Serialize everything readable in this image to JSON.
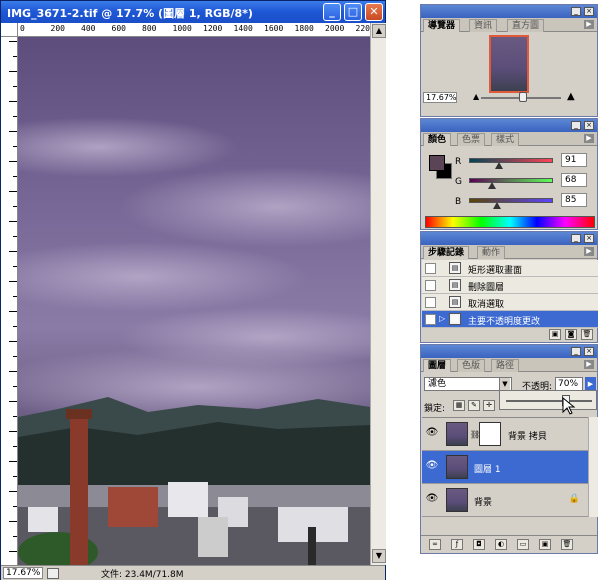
{
  "document_window": {
    "title": "IMG_3671-2.tif @ 17.7% (圖層 1, RGB/8*)",
    "buttons": {
      "minimize": "_",
      "maximize": "□",
      "close": "✕"
    },
    "ruler_ticks": [
      "0",
      "200",
      "400",
      "600",
      "800",
      "1000",
      "1200",
      "1400",
      "1600",
      "1800",
      "2000",
      "2200"
    ],
    "status": {
      "zoom": "17.67%",
      "doc_info": "文件: 23.4M/71.8M"
    }
  },
  "navigator_panel": {
    "tabs": [
      "導覽器",
      "資訊",
      "直方圖"
    ],
    "zoom": "17.67%"
  },
  "color_panel": {
    "tabs": [
      "顏色",
      "色票",
      "樣式"
    ],
    "channels": [
      {
        "label": "R",
        "value": "91",
        "fraction": 0.36,
        "gradient": "linear-gradient(to right,#004455,#ff4455)"
      },
      {
        "label": "G",
        "value": "68",
        "fraction": 0.27,
        "gradient": "linear-gradient(to right,#5b0055,#5bff55)"
      },
      {
        "label": "B",
        "value": "85",
        "fraction": 0.33,
        "gradient": "linear-gradient(to right,#5b4400,#5b44ff)"
      }
    ],
    "foreground": "#5b4455",
    "background": "#000000"
  },
  "history_panel": {
    "tabs": [
      "步驟記錄",
      "動作"
    ],
    "items": [
      {
        "label": "矩形選取畫面",
        "selected": false
      },
      {
        "label": "刪除圖層",
        "selected": false
      },
      {
        "label": "取消選取",
        "selected": false
      },
      {
        "label": "主要不透明度更改",
        "selected": true
      }
    ]
  },
  "layers_panel": {
    "tabs": [
      "圖層",
      "色版",
      "路徑"
    ],
    "blend_mode": "濾色",
    "opacity_label": "不透明:",
    "opacity_value": "70%",
    "lock_label": "鎖定:",
    "layers": [
      {
        "name": "背景 拷貝",
        "has_mask": true,
        "selected": false,
        "locked": false
      },
      {
        "name": "圖層 1",
        "has_mask": false,
        "selected": true,
        "locked": false
      },
      {
        "name": "背景",
        "has_mask": false,
        "selected": false,
        "locked": true
      }
    ]
  }
}
